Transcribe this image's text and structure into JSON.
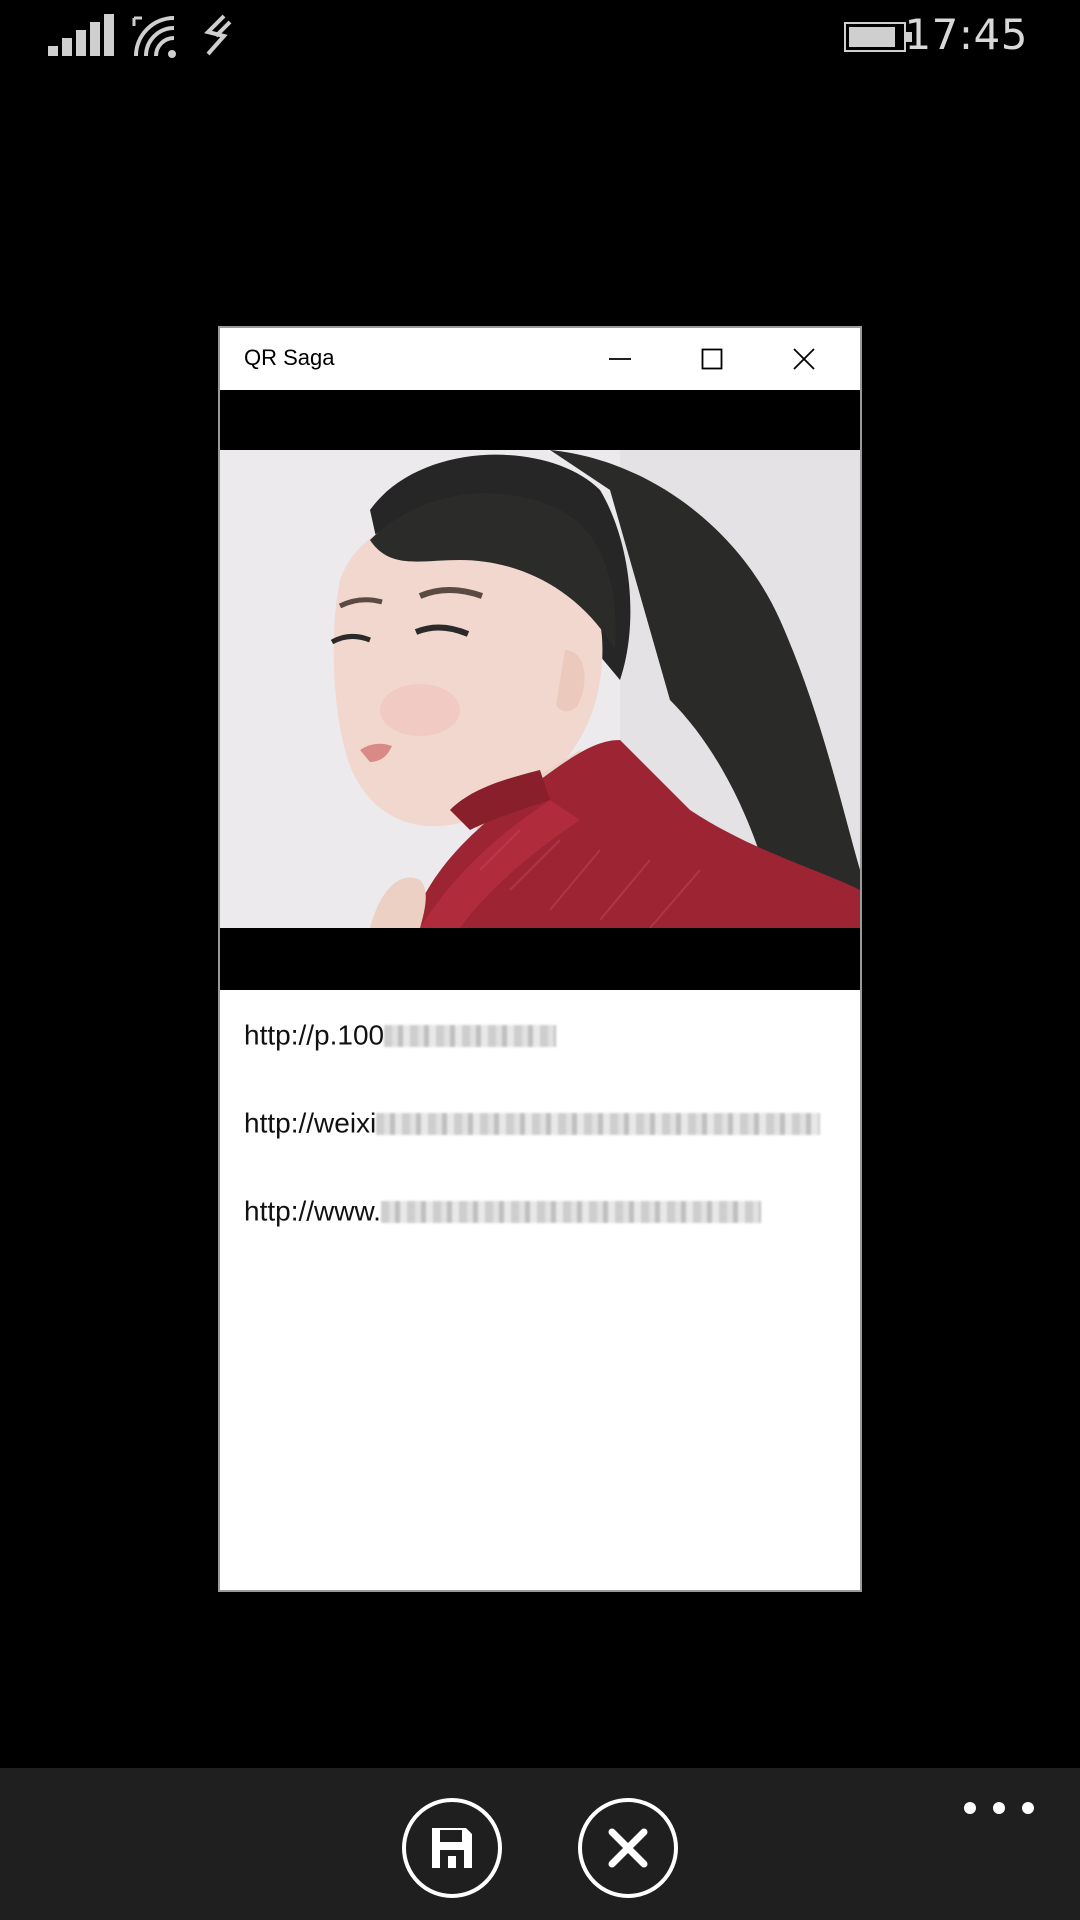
{
  "status_bar": {
    "time": "17:45",
    "icons": [
      "signal-icon",
      "wifi-icon",
      "data-icon",
      "battery-icon"
    ]
  },
  "window": {
    "title": "QR Saga",
    "controls": [
      "minimize-icon",
      "maximize-icon",
      "close-icon"
    ]
  },
  "links": [
    {
      "visible_text": "http://p.100"
    },
    {
      "visible_text": "http://weixi"
    },
    {
      "visible_text": "http://www."
    }
  ],
  "app_bar": {
    "buttons": [
      "save-icon",
      "cancel-icon",
      "more-icon"
    ]
  },
  "colors": {
    "background": "#000000",
    "app_bar": "#1f1f1f",
    "window": "#ffffff",
    "status_text": "#d8d8d8"
  }
}
